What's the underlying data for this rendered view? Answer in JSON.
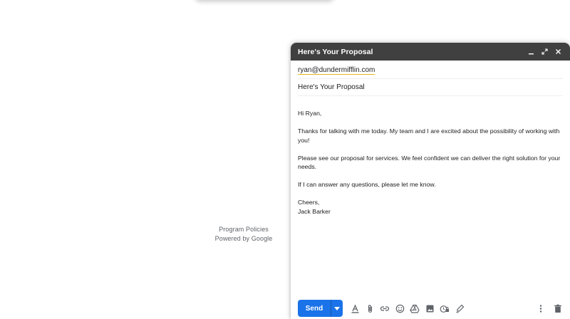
{
  "footer": {
    "program_policies": "Program Policies",
    "powered_by": "Powered by Google"
  },
  "compose": {
    "title": "Here's Your Proposal",
    "to": "ryan@dundermifflin.com",
    "subject": "Here's Your Proposal",
    "body": {
      "greeting": "Hi Ryan,",
      "para1": "Thanks for talking with me today. My team and I are excited about the possibility of working with you!",
      "para2": "Please see our proposal for services. We feel confident we can deliver the right solution for your needs.",
      "para3": "If I can answer any questions, please let me know.",
      "closing": "Cheers,",
      "signature": "Jack Barker"
    },
    "send_label": "Send",
    "titlebar_icons": [
      "minimize-icon",
      "expand-icon",
      "close-icon"
    ],
    "toolbar_icons": [
      "formatting-icon",
      "attach-icon",
      "link-icon",
      "emoji-icon",
      "drive-icon",
      "photo-icon",
      "confidential-icon",
      "signature-icon"
    ],
    "right_icons": [
      "more-options-icon",
      "trash-icon"
    ]
  },
  "colors": {
    "titlebar_bg": "#404040",
    "send_blue": "#1a73e8",
    "spell_underline": "#e8b620"
  }
}
